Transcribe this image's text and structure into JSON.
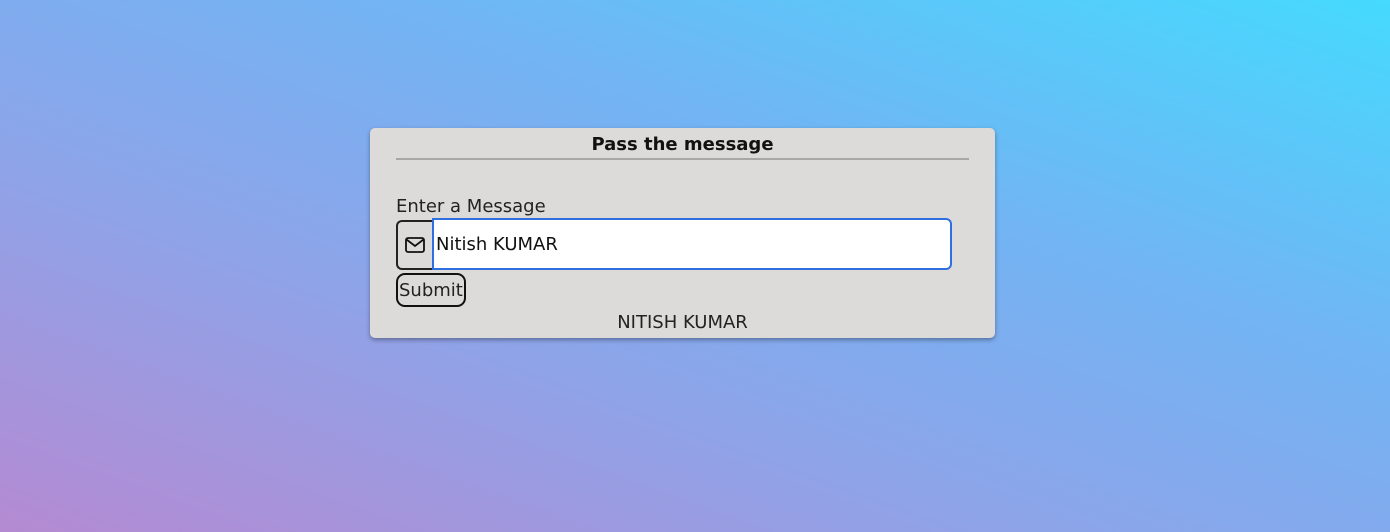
{
  "card": {
    "title": "Pass the message"
  },
  "form": {
    "label": "Enter a Message",
    "input_value": "Nitish KUMAR",
    "submit_label": "Submit",
    "icon": "envelope-icon"
  },
  "output": {
    "text": "NITISH KUMAR"
  },
  "colors": {
    "input_focus_border": "#2f6fe0",
    "card_background": "#dddbd9"
  }
}
